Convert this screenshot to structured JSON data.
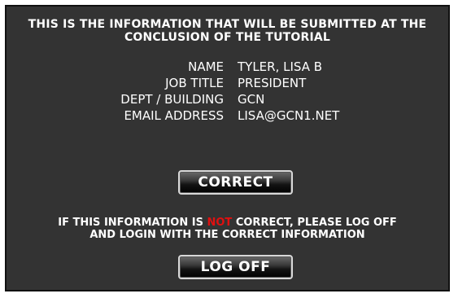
{
  "header": {
    "line1": "THIS IS THE INFORMATION THAT WILL BE SUBMITTED AT THE",
    "line2": "CONCLUSION OF THE TUTORIAL"
  },
  "fields": [
    {
      "label": "NAME",
      "value": "TYLER, LISA B"
    },
    {
      "label": "JOB TITLE",
      "value": "PRESIDENT"
    },
    {
      "label": "DEPT / BUILDING",
      "value": "GCN"
    },
    {
      "label": "EMAIL ADDRESS",
      "value": "LISA@GCN1.NET"
    }
  ],
  "buttons": {
    "correct_label": "CORRECT",
    "logoff_label": "LOG OFF"
  },
  "notice": {
    "pre": "IF THIS INFORMATION IS",
    "highlight": "NOT",
    "post": "CORRECT, PLEASE LOG OFF",
    "line2": "AND LOGIN WITH THE CORRECT INFORMATION"
  },
  "colors": {
    "panel_bg": "#333333",
    "text": "#ffffff",
    "highlight": "#e01010"
  }
}
